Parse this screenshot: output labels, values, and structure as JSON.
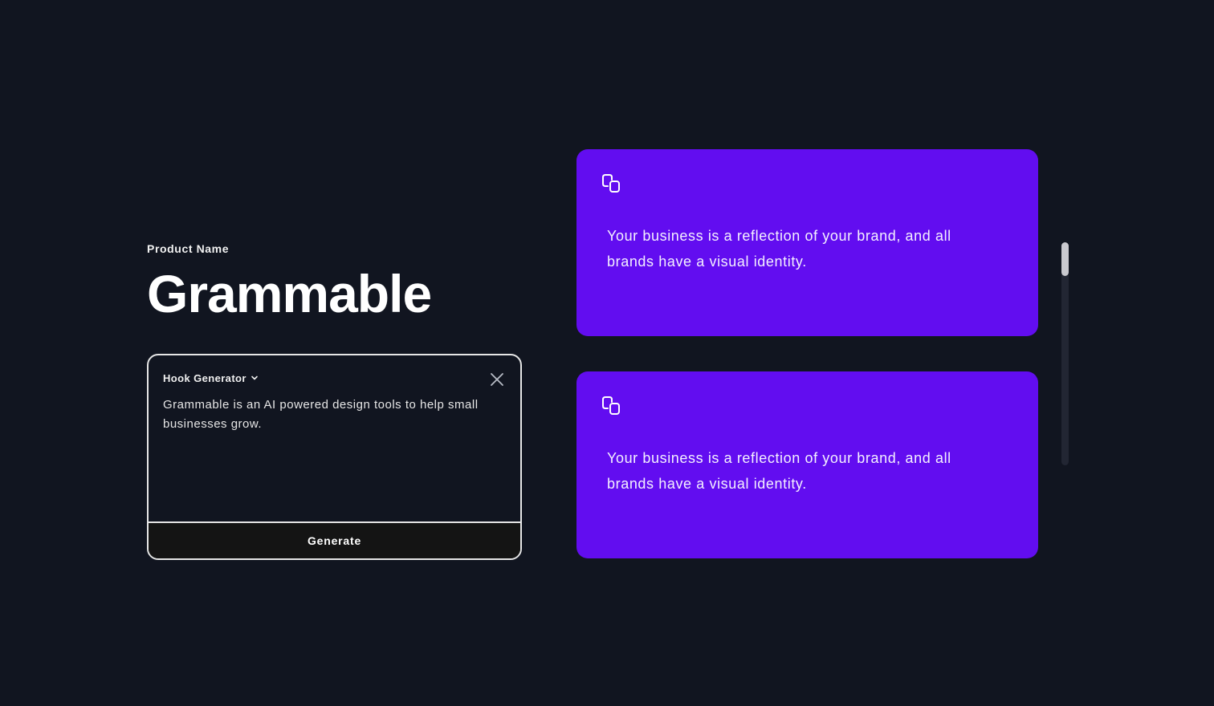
{
  "header": {
    "eyebrow": "Product Name",
    "title": "Grammable"
  },
  "input_card": {
    "tool_dropdown": "Hook Generator",
    "prompt": "Grammable is an AI powered design tools to help small businesses grow.",
    "generate_label": "Generate",
    "icons": {
      "dropdown": "chevron-down-icon",
      "close": "close-icon"
    }
  },
  "results": [
    {
      "text": "Your business is a reflection of your brand, and all brands have a visual identity.",
      "icon": "copy-icon"
    },
    {
      "text": "Your business is a reflection of your brand, and all brands have a visual identity.",
      "icon": "copy-icon"
    }
  ],
  "colors": {
    "background": "#111520",
    "result_card": "#620df0",
    "border": "#e6e6e6",
    "button": "#141414"
  }
}
